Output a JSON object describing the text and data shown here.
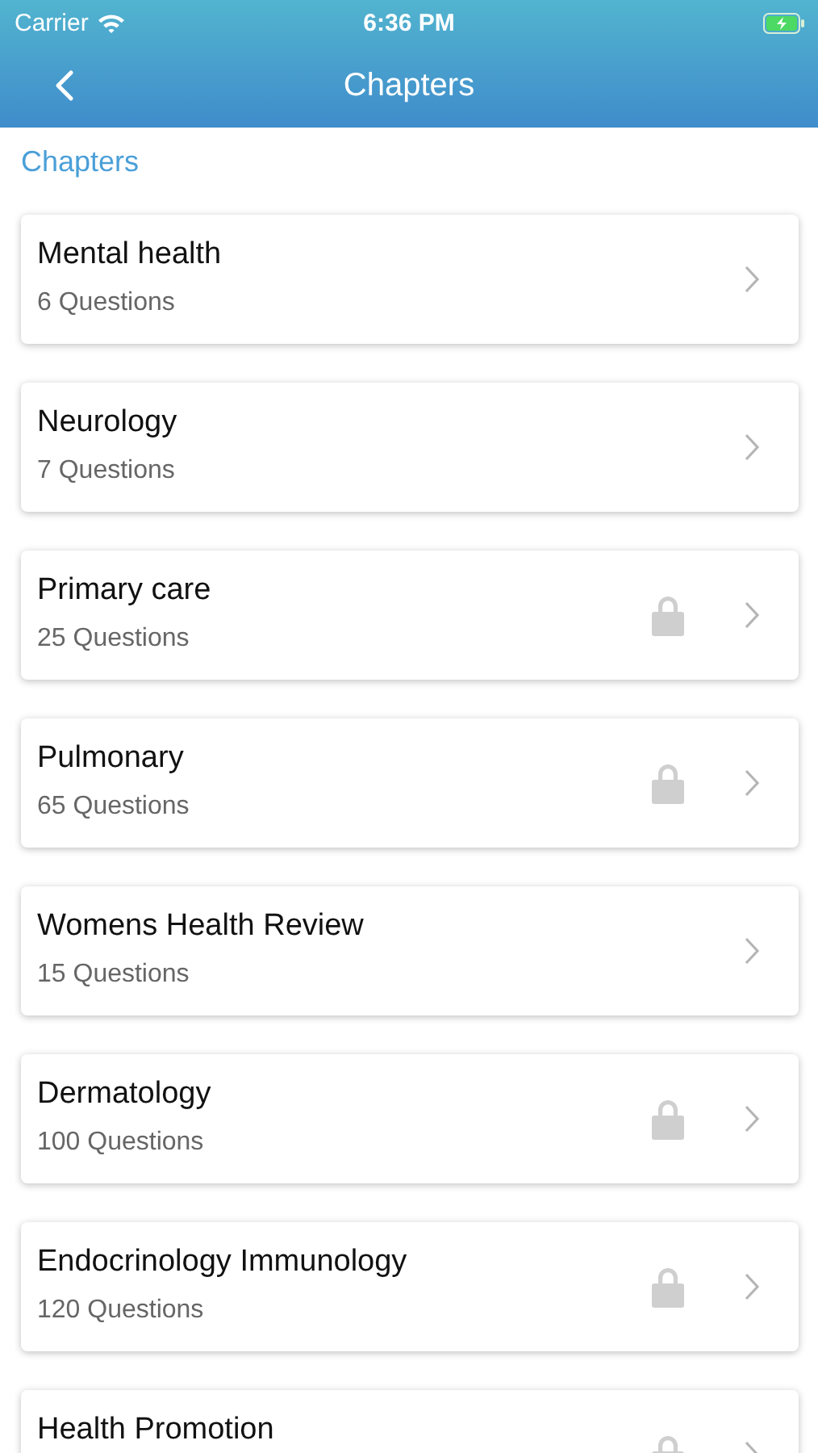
{
  "status_bar": {
    "carrier": "Carrier",
    "time": "6:36 PM"
  },
  "nav": {
    "title": "Chapters"
  },
  "section_label": "Chapters",
  "chapters": [
    {
      "name": "Mental health",
      "questions": "6 Questions",
      "locked": false
    },
    {
      "name": "Neurology",
      "questions": "7 Questions",
      "locked": false
    },
    {
      "name": "Primary care",
      "questions": "25 Questions",
      "locked": true
    },
    {
      "name": "Pulmonary",
      "questions": "65 Questions",
      "locked": true
    },
    {
      "name": "Womens Health Review",
      "questions": "15 Questions",
      "locked": false
    },
    {
      "name": "Dermatology",
      "questions": "100 Questions",
      "locked": true
    },
    {
      "name": "Endocrinology Immunology",
      "questions": "120 Questions",
      "locked": true
    },
    {
      "name": "Health Promotion",
      "locked": true
    }
  ]
}
